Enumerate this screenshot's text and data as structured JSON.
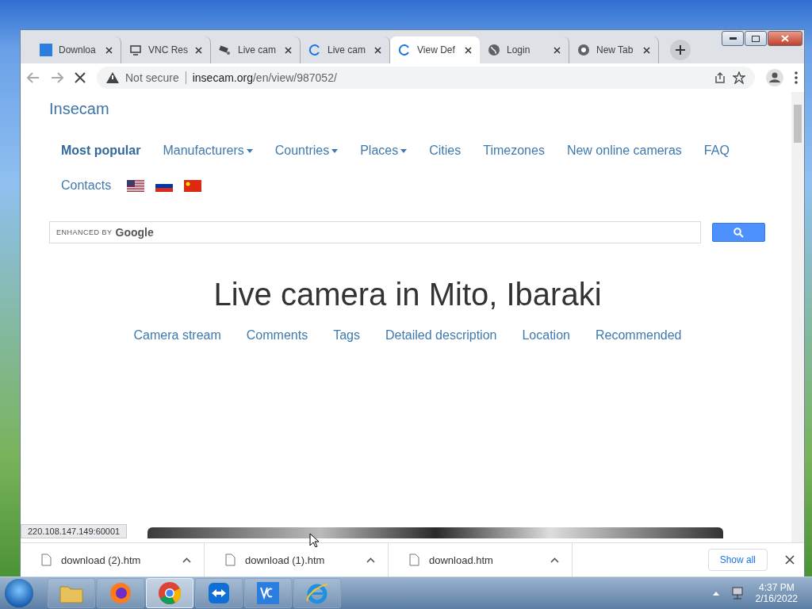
{
  "tabs": [
    {
      "label": "Downloa",
      "kind": "vnc",
      "selected": false
    },
    {
      "label": "VNC Res",
      "kind": "viewer",
      "selected": false
    },
    {
      "label": "Live cam",
      "kind": "camera",
      "selected": false
    },
    {
      "label": "Live cam",
      "kind": "spinner",
      "selected": false
    },
    {
      "label": "View Def",
      "kind": "spinner",
      "selected": true
    },
    {
      "label": "Login",
      "kind": "globe",
      "selected": false
    },
    {
      "label": "New Tab",
      "kind": "chrome",
      "selected": false
    }
  ],
  "toolbar": {
    "security": "Not secure",
    "url_host": "insecam.org",
    "url_path": "/en/view/987052/"
  },
  "site": {
    "brand": "Insecam",
    "nav": [
      {
        "label": "Most popular",
        "dropdown": false,
        "selected": true
      },
      {
        "label": "Manufacturers",
        "dropdown": true,
        "selected": false
      },
      {
        "label": "Countries",
        "dropdown": true,
        "selected": false
      },
      {
        "label": "Places",
        "dropdown": true,
        "selected": false
      },
      {
        "label": "Cities",
        "dropdown": false,
        "selected": false
      },
      {
        "label": "Timezones",
        "dropdown": false,
        "selected": false
      },
      {
        "label": "New online cameras",
        "dropdown": false,
        "selected": false
      },
      {
        "label": "FAQ",
        "dropdown": false,
        "selected": false
      },
      {
        "label": "Contacts",
        "dropdown": false,
        "selected": false
      }
    ],
    "flags": [
      {
        "kind": "us"
      },
      {
        "kind": "ru"
      },
      {
        "kind": "cn"
      }
    ],
    "search": {
      "hint_prefix": "ENHANCED BY",
      "hint_brand": "Google"
    },
    "heading": "Live camera in Mito, Ibaraki",
    "sections": [
      "Camera stream",
      "Comments",
      "Tags",
      "Detailed description",
      "Location",
      "Recommended"
    ]
  },
  "status_url": "220.108.147.149:60001",
  "downloads": {
    "files": [
      "download (2).htm",
      "download (1).htm",
      "download.htm"
    ],
    "show_all": "Show all"
  },
  "taskbar": {
    "apps": [
      {
        "kind": "folder",
        "selected": false
      },
      {
        "kind": "firefox",
        "selected": false
      },
      {
        "kind": "chrome",
        "selected": true
      },
      {
        "kind": "teamviewer",
        "selected": false
      },
      {
        "kind": "vnc",
        "selected": false
      },
      {
        "kind": "ie",
        "selected": false
      }
    ],
    "time": "4:37 PM",
    "date": "2/16/2022"
  }
}
